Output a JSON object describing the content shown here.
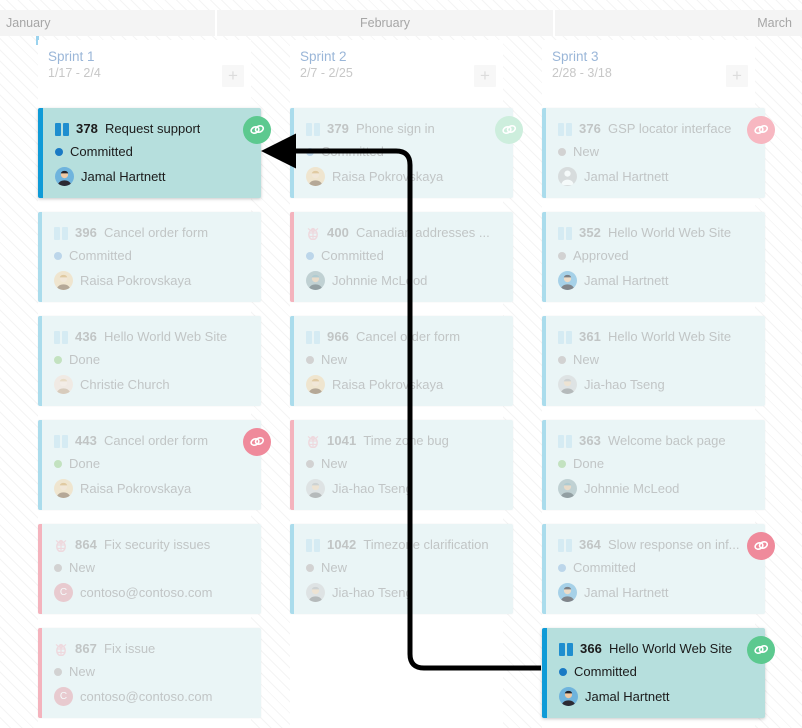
{
  "timeline": {
    "months": [
      {
        "label": "January",
        "align": "left"
      },
      {
        "label": "February",
        "align": "center"
      },
      {
        "label": "March",
        "align": "right"
      }
    ]
  },
  "add_label": "+",
  "columns": [
    {
      "title": "Sprint 1",
      "dates": "1/17 - 2/4",
      "cards": [
        {
          "id": "378",
          "title": "Request support",
          "type": "pbi",
          "state": "Committed",
          "state_kind": "committed",
          "assignee": "Jamal Hartnett",
          "avatar": "photo-male-dark",
          "selected": true,
          "link_badge": "green"
        },
        {
          "id": "396",
          "title": "Cancel order form",
          "type": "pbi",
          "state": "Committed",
          "state_kind": "committed",
          "assignee": "Raisa Pokrovskaya",
          "avatar": "photo-female-blonde",
          "selected": false,
          "link_badge": null
        },
        {
          "id": "436",
          "title": "Hello World Web Site",
          "type": "pbi",
          "state": "Done",
          "state_kind": "done",
          "assignee": "Christie Church",
          "avatar": "photo-female-light",
          "selected": false,
          "link_badge": null
        },
        {
          "id": "443",
          "title": "Cancel order form",
          "type": "pbi",
          "state": "Done",
          "state_kind": "done",
          "assignee": "Raisa Pokrovskaya",
          "avatar": "photo-female-blonde",
          "selected": false,
          "link_badge": "red"
        },
        {
          "id": "864",
          "title": "Fix security issues",
          "type": "bug",
          "state": "New",
          "state_kind": "new",
          "assignee": "contoso@contoso.com",
          "avatar": "initial-c",
          "selected": false,
          "link_badge": null
        },
        {
          "id": "867",
          "title": "Fix issue",
          "type": "bug",
          "state": "New",
          "state_kind": "new",
          "assignee": "contoso@contoso.com",
          "avatar": "initial-c",
          "selected": false,
          "link_badge": null
        }
      ]
    },
    {
      "title": "Sprint 2",
      "dates": "2/7 - 2/25",
      "cards": [
        {
          "id": "379",
          "title": "Phone sign in",
          "type": "pbi",
          "state": "Committed",
          "state_kind": "committed",
          "assignee": "Raisa Pokrovskaya",
          "avatar": "photo-female-blonde",
          "selected": false,
          "link_badge": "green-faded"
        },
        {
          "id": "400",
          "title": "Canadian addresses ...",
          "type": "bug",
          "state": "Committed",
          "state_kind": "committed",
          "assignee": "Johnnie McLeod",
          "avatar": "photo-male-cap",
          "selected": false,
          "link_badge": null
        },
        {
          "id": "966",
          "title": "Cancel order form",
          "type": "pbi",
          "state": "New",
          "state_kind": "new",
          "assignee": "Raisa Pokrovskaya",
          "avatar": "photo-female-blonde",
          "selected": false,
          "link_badge": null
        },
        {
          "id": "1041",
          "title": "Time zone bug",
          "type": "bug",
          "state": "New",
          "state_kind": "new",
          "assignee": "Jia-hao Tseng",
          "avatar": "photo-male-grey",
          "selected": false,
          "link_badge": null
        },
        {
          "id": "1042",
          "title": "Timezone clarification",
          "type": "pbi",
          "state": "New",
          "state_kind": "new",
          "assignee": "Jia-hao Tseng",
          "avatar": "photo-male-grey",
          "selected": false,
          "link_badge": null
        }
      ]
    },
    {
      "title": "Sprint 3",
      "dates": "2/28 - 3/18",
      "cards": [
        {
          "id": "376",
          "title": "GSP locator interface",
          "type": "pbi",
          "state": "New",
          "state_kind": "new",
          "assignee": "Jamal Hartnett",
          "avatar": "generic-person",
          "selected": false,
          "link_badge": "red-faded"
        },
        {
          "id": "352",
          "title": "Hello World Web Site",
          "type": "pbi",
          "state": "Approved",
          "state_kind": "approved",
          "assignee": "Jamal Hartnett",
          "avatar": "photo-male-dark",
          "selected": false,
          "link_badge": null
        },
        {
          "id": "361",
          "title": "Hello World Web Site",
          "type": "pbi",
          "state": "New",
          "state_kind": "new",
          "assignee": "Jia-hao Tseng",
          "avatar": "photo-male-grey",
          "selected": false,
          "link_badge": null
        },
        {
          "id": "363",
          "title": "Welcome back page",
          "type": "pbi",
          "state": "Done",
          "state_kind": "done",
          "assignee": "Johnnie McLeod",
          "avatar": "photo-male-cap",
          "selected": false,
          "link_badge": null
        },
        {
          "id": "364",
          "title": "Slow response on inf...",
          "type": "pbi",
          "state": "Committed",
          "state_kind": "committed",
          "assignee": "Jamal Hartnett",
          "avatar": "photo-male-dark",
          "selected": false,
          "link_badge": "red"
        },
        {
          "id": "366",
          "title": "Hello World Web Site",
          "type": "pbi",
          "state": "Committed",
          "state_kind": "committed",
          "assignee": "Jamal Hartnett",
          "avatar": "photo-male-dark",
          "selected": true,
          "link_badge": "green"
        }
      ]
    }
  ],
  "connector": {
    "from_card_id": "366",
    "to_card_id": "378",
    "color": "#000000"
  },
  "colors": {
    "selected_card_bg": "#b6dfdd",
    "selected_card_border": "#0f9bd7",
    "card_bg": "#eaf5f6",
    "pbi_border": "#aadcec",
    "bug_border": "#f4b3bd",
    "link_green": "#5cc98f",
    "link_red": "#ef8a9b",
    "sprint_title": "#9ab6d8"
  }
}
